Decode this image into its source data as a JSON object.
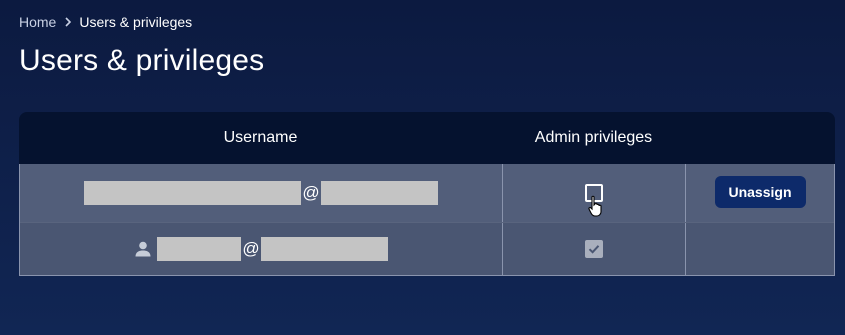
{
  "breadcrumb": {
    "home": "Home",
    "current": "Users & privileges"
  },
  "page": {
    "title": "Users & privileges"
  },
  "table": {
    "columns": {
      "username": "Username",
      "admin": "Admin privileges",
      "action": ""
    },
    "rows": [
      {
        "username_at": "@",
        "admin_checked": false,
        "action_label": "Unassign"
      },
      {
        "username_at": "@",
        "admin_checked": true
      }
    ]
  },
  "colors": {
    "background": "#0c1a40",
    "header": "#05122f",
    "row": "#4a5672",
    "button": "#0d2a6a",
    "redaction": "#c4c4c4"
  },
  "icons": {
    "breadcrumb_separator": "chevron-right-icon",
    "user": "person-icon",
    "pointer": "hand-pointer-icon"
  }
}
